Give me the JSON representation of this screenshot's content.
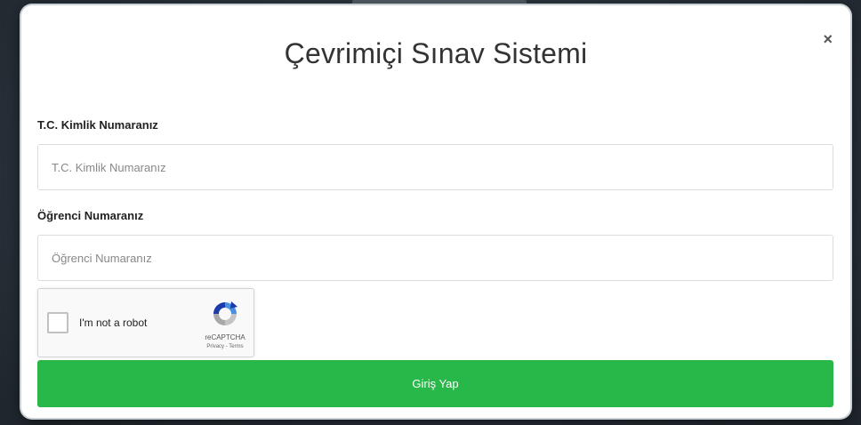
{
  "modal": {
    "title": "Çevrimiçi Sınav Sistemi",
    "close_label": "×"
  },
  "form": {
    "tc_label": "T.C. Kimlik Numaranız",
    "tc_placeholder": "T.C. Kimlik Numaranız",
    "student_label": "Öğrenci Numaranız",
    "student_placeholder": "Öğrenci Numaranız",
    "submit_label": "Giriş Yap"
  },
  "recaptcha": {
    "checkbox_label": "I'm not a robot",
    "brand": "reCAPTCHA",
    "links": "Privacy - Terms",
    "icon": "recaptcha-logo-icon"
  },
  "colors": {
    "submit_bg": "#28b84a",
    "backdrop": "#2a333c"
  }
}
